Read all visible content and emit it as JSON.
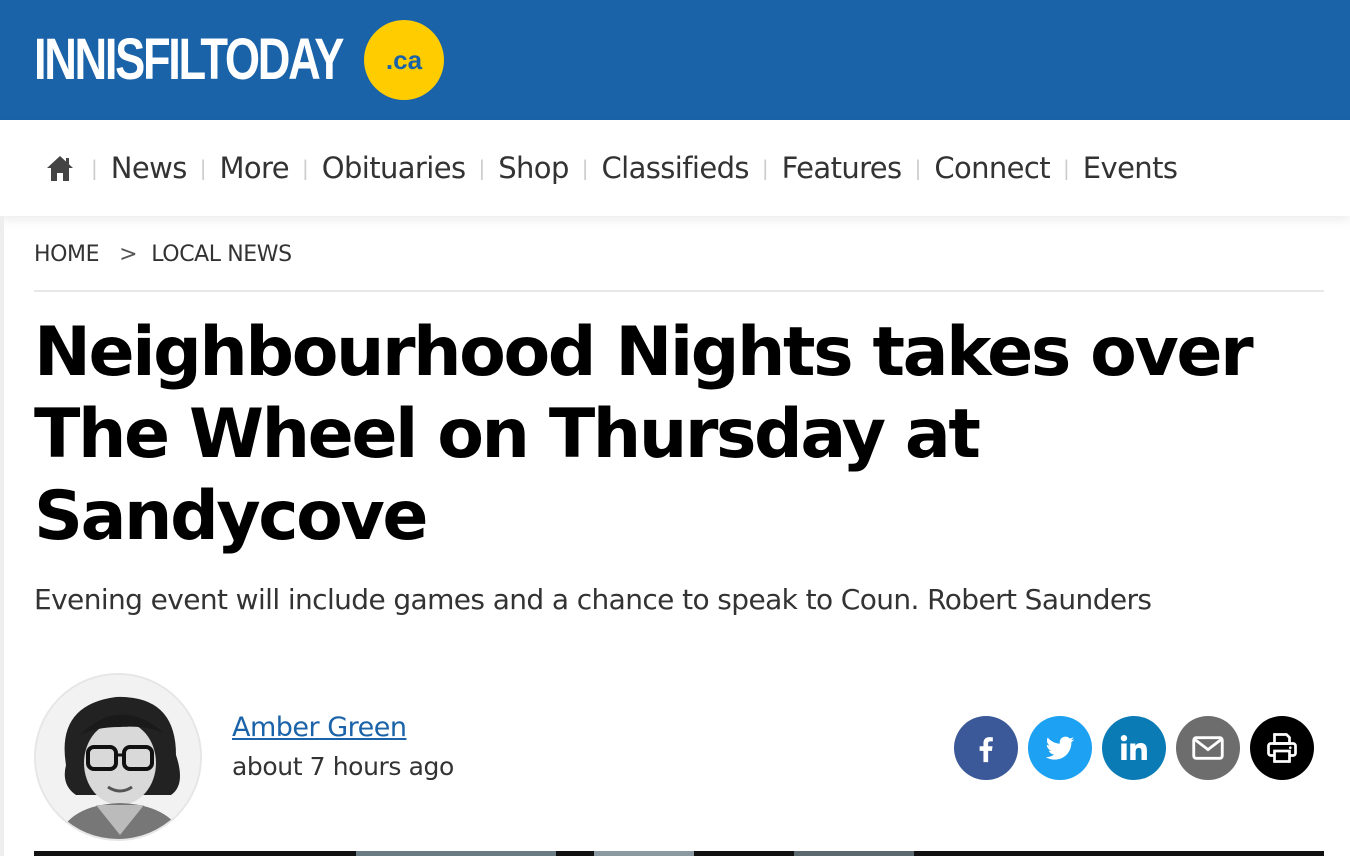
{
  "header": {
    "logo_text": "INNISFILTODAY",
    "logo_suffix": ".ca",
    "brand_color": "#1b63a9",
    "accent_color": "#ffcc00"
  },
  "nav": {
    "home_icon": "home-icon",
    "items": [
      "News",
      "More",
      "Obituaries",
      "Shop",
      "Classifieds",
      "Features",
      "Connect",
      "Events"
    ]
  },
  "breadcrumb": {
    "home": "HOME",
    "separator": ">",
    "section": "LOCAL NEWS"
  },
  "article": {
    "headline_lines": [
      "Neighbourhood Nights takes over",
      "The Wheel on Thursday at",
      "Sandycove"
    ],
    "subhead": "Evening event will include games and a chance to speak to Coun. Robert Saunders",
    "author": "Amber Green",
    "published": "about 7 hours ago"
  },
  "share": {
    "buttons": [
      {
        "icon": "facebook-icon",
        "color": "#3b5998"
      },
      {
        "icon": "twitter-icon",
        "color": "#1da1f2"
      },
      {
        "icon": "linkedin-icon",
        "color": "#0a7bb5"
      },
      {
        "icon": "email-icon",
        "color": "#6d6d6d"
      },
      {
        "icon": "print-icon",
        "color": "#000000"
      }
    ]
  }
}
